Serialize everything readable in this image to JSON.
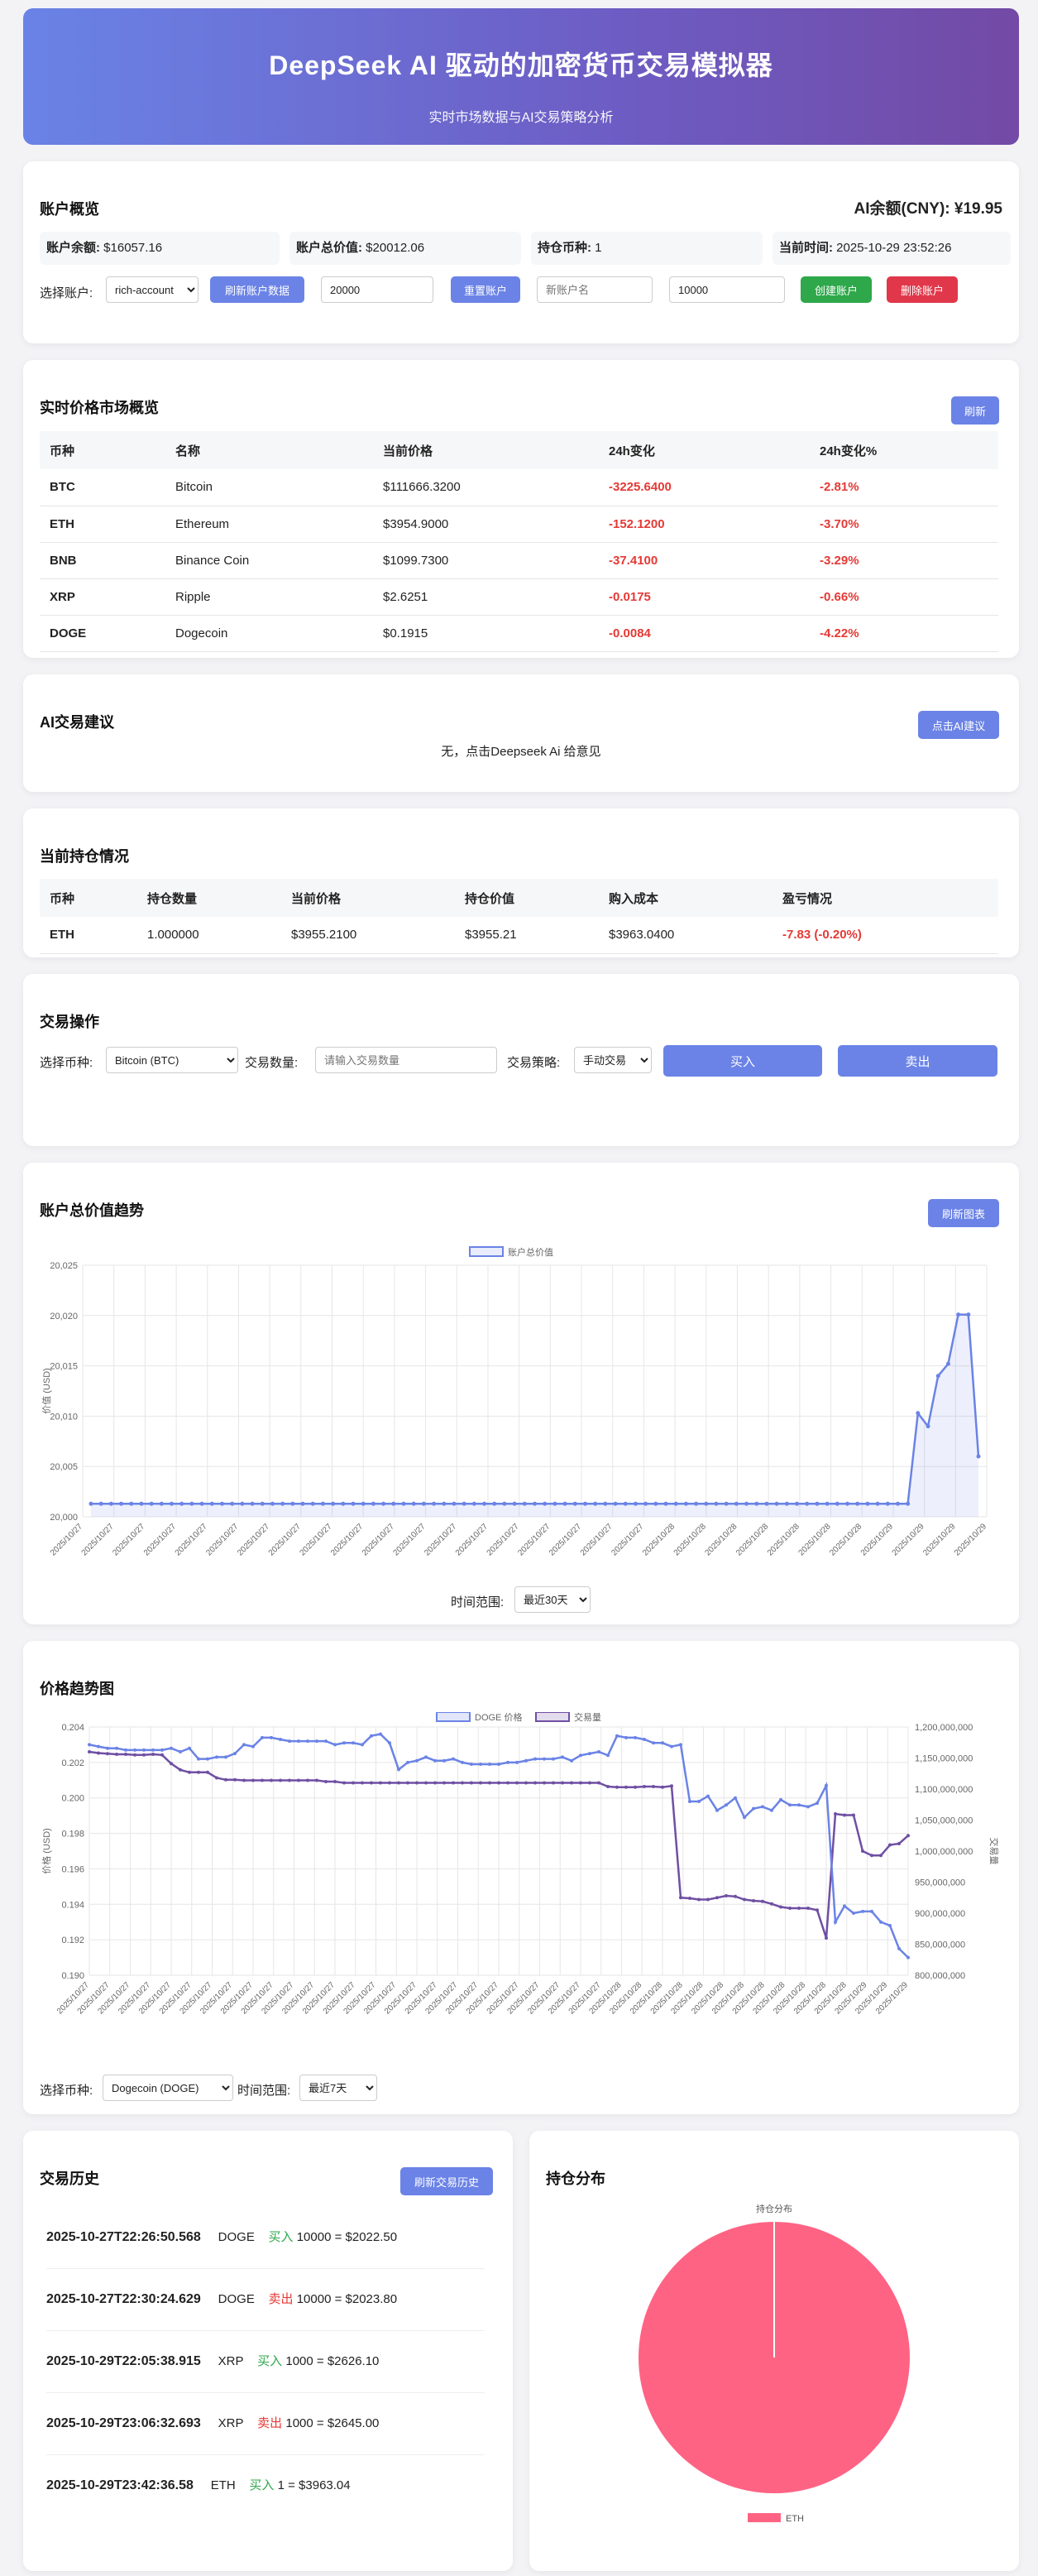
{
  "header": {
    "title": "DeepSeek AI 驱动的加密货币交易模拟器",
    "subtitle": "实时市场数据与AI交易策略分析"
  },
  "account": {
    "title": "账户概览",
    "ai_balance": "AI余额(CNY): ¥19.95",
    "balance_label": "账户余额:",
    "balance": "$16057.16",
    "total_label": "账户总价值:",
    "total": "$20012.06",
    "coins_label": "持仓币种:",
    "coins": "1",
    "time_label": "当前时间:",
    "time": "2025-10-29 23:52:26",
    "select_label": "选择账户:",
    "selected_account": "rich-account",
    "refresh_btn": "刷新账户数据",
    "reset_value": "20000",
    "reset_btn": "重置账户",
    "new_name_placeholder": "新账户名",
    "new_amount": "10000",
    "create_btn": "创建账户",
    "delete_btn": "删除账户"
  },
  "market": {
    "title": "实时价格市场概览",
    "refresh_btn": "刷新",
    "columns": [
      "币种",
      "名称",
      "当前价格",
      "24h变化",
      "24h变化%"
    ],
    "rows": [
      [
        "BTC",
        "Bitcoin",
        "$111666.3200",
        "-3225.6400",
        "-2.81%"
      ],
      [
        "ETH",
        "Ethereum",
        "$3954.9000",
        "-152.1200",
        "-3.70%"
      ],
      [
        "BNB",
        "Binance Coin",
        "$1099.7300",
        "-37.4100",
        "-3.29%"
      ],
      [
        "XRP",
        "Ripple",
        "$2.6251",
        "-0.0175",
        "-0.66%"
      ],
      [
        "DOGE",
        "Dogecoin",
        "$0.1915",
        "-0.0084",
        "-4.22%"
      ]
    ]
  },
  "ai": {
    "title": "AI交易建议",
    "btn": "点击AI建议",
    "text": "无，点击Deepseek Ai 给意见"
  },
  "holdings": {
    "title": "当前持仓情况",
    "columns": [
      "币种",
      "持仓数量",
      "当前价格",
      "持仓价值",
      "购入成本",
      "盈亏情况"
    ],
    "rows": [
      [
        "ETH",
        "1.000000",
        "$3955.2100",
        "$3955.21",
        "$3963.0400",
        "-7.83 (-0.20%)"
      ]
    ]
  },
  "trade": {
    "title": "交易操作",
    "coin_label": "选择币种:",
    "coin_value": "Bitcoin (BTC)",
    "qty_label": "交易数量:",
    "qty_placeholder": "请输入交易数量",
    "strategy_label": "交易策略:",
    "strategy_value": "手动交易",
    "buy_btn": "买入",
    "sell_btn": "卖出"
  },
  "value_chart": {
    "title": "账户总价值趋势",
    "refresh_btn": "刷新图表",
    "range_label": "时间范围:",
    "range_value": "最近30天"
  },
  "price_chart": {
    "title": "价格趋势图",
    "coin_label": "选择币种:",
    "coin_value": "Dogecoin (DOGE)",
    "range_label": "时间范围:",
    "range_value": "最近7天"
  },
  "history": {
    "title": "交易历史",
    "refresh_btn": "刷新交易历史",
    "items": [
      {
        "time": "2025-10-27T22:26:50.568",
        "coin": "DOGE",
        "side": "买入",
        "type": "buy",
        "detail": "10000 = $2022.50"
      },
      {
        "time": "2025-10-27T22:30:24.629",
        "coin": "DOGE",
        "side": "卖出",
        "type": "sell",
        "detail": "10000 = $2023.80"
      },
      {
        "time": "2025-10-29T22:05:38.915",
        "coin": "XRP",
        "side": "买入",
        "type": "buy",
        "detail": "1000 = $2626.10"
      },
      {
        "time": "2025-10-29T23:06:32.693",
        "coin": "XRP",
        "side": "卖出",
        "type": "sell",
        "detail": "1000 = $2645.00"
      },
      {
        "time": "2025-10-29T23:42:36.58",
        "coin": "ETH",
        "side": "买入",
        "type": "buy",
        "detail": "1 = $3963.04"
      }
    ]
  },
  "distribution": {
    "title": "持仓分布"
  },
  "chart_data": [
    {
      "type": "area",
      "title": "",
      "xlabel": "",
      "ylabel": "价值 (USD)",
      "ylim": [
        20000,
        20025
      ],
      "grid": true,
      "legend": "top-center",
      "color": "#6b83e6",
      "tick_label": "2025/10/27",
      "x_ticks": [
        "2025/10/27",
        "2025/10/27",
        "2025/10/27",
        "2025/10/27",
        "2025/10/27",
        "2025/10/27",
        "2025/10/27",
        "2025/10/27",
        "2025/10/27",
        "2025/10/27",
        "2025/10/27",
        "2025/10/27",
        "2025/10/27",
        "2025/10/27",
        "2025/10/27",
        "2025/10/27",
        "2025/10/27",
        "2025/10/27",
        "2025/10/27",
        "2025/10/28",
        "2025/10/28",
        "2025/10/28",
        "2025/10/28",
        "2025/10/28",
        "2025/10/28",
        "2025/10/28",
        "2025/10/29",
        "2025/10/29",
        "2025/10/29",
        "2025/10/29"
      ],
      "y_ticks": [
        "20,025",
        "20,020",
        "20,015",
        "20,010",
        "20,005",
        "20,000"
      ],
      "series": [
        {
          "name": "账户总价值",
          "values": [
            20001.3,
            20001.3,
            20001.3,
            20001.3,
            20001.3,
            20001.3,
            20001.3,
            20001.3,
            20001.3,
            20001.3,
            20001.3,
            20001.3,
            20001.3,
            20001.3,
            20001.3,
            20001.3,
            20001.3,
            20001.3,
            20001.3,
            20001.3,
            20001.3,
            20001.3,
            20001.3,
            20001.3,
            20001.3,
            20001.3,
            20001.3,
            20001.3,
            20001.3,
            20001.3,
            20001.3,
            20001.3,
            20001.3,
            20001.3,
            20001.3,
            20001.3,
            20001.3,
            20001.3,
            20001.3,
            20001.3,
            20001.3,
            20001.3,
            20001.3,
            20001.3,
            20001.3,
            20001.3,
            20001.3,
            20001.3,
            20001.3,
            20001.3,
            20001.3,
            20001.3,
            20001.3,
            20001.3,
            20001.3,
            20001.3,
            20001.3,
            20001.3,
            20001.3,
            20001.3,
            20001.3,
            20001.3,
            20001.3,
            20001.3,
            20001.3,
            20001.3,
            20001.3,
            20001.3,
            20001.3,
            20001.3,
            20001.3,
            20001.3,
            20001.3,
            20001.3,
            20001.3,
            20001.3,
            20001.3,
            20001.3,
            20001.3,
            20001.3,
            20001.3,
            20001.3,
            20010.3,
            20009.0,
            20014.0,
            20015.2,
            20020.1,
            20020.1,
            20006.0
          ]
        }
      ]
    },
    {
      "type": "line",
      "title": "",
      "xlabel": "",
      "ylabel": "价格 (USD)",
      "y2label": "交易量",
      "ylim": [
        0.19,
        0.204
      ],
      "y2lim": [
        800000000,
        1200000000
      ],
      "grid": true,
      "legend": "top-center",
      "x_ticks": [
        "2025/10/27",
        "2025/10/27",
        "2025/10/27",
        "2025/10/27",
        "2025/10/27",
        "2025/10/27",
        "2025/10/27",
        "2025/10/27",
        "2025/10/27",
        "2025/10/27",
        "2025/10/27",
        "2025/10/27",
        "2025/10/27",
        "2025/10/27",
        "2025/10/27",
        "2025/10/27",
        "2025/10/27",
        "2025/10/27",
        "2025/10/27",
        "2025/10/27",
        "2025/10/27",
        "2025/10/27",
        "2025/10/27",
        "2025/10/27",
        "2025/10/27",
        "2025/10/27",
        "2025/10/28",
        "2025/10/28",
        "2025/10/28",
        "2025/10/28",
        "2025/10/28",
        "2025/10/28",
        "2025/10/28",
        "2025/10/28",
        "2025/10/28",
        "2025/10/28",
        "2025/10/28",
        "2025/10/28",
        "2025/10/29",
        "2025/10/29",
        "2025/10/29"
      ],
      "y_ticks": [
        "0.204",
        "0.202",
        "0.200",
        "0.198",
        "0.196",
        "0.194",
        "0.192",
        "0.190"
      ],
      "y2_ticks": [
        "1,200,000,000",
        "1,150,000,000",
        "1,100,000,000",
        "1,050,000,000",
        "1,000,000,000",
        "950,000,000",
        "900,000,000",
        "850,000,000",
        "800,000,000"
      ],
      "series": [
        {
          "name": "DOGE 价格",
          "color": "#6b83e6",
          "values": [
            0.203,
            0.2029,
            0.2028,
            0.2028,
            0.2027,
            0.2027,
            0.2027,
            0.2027,
            0.2027,
            0.2028,
            0.2026,
            0.2028,
            0.2022,
            0.2022,
            0.2023,
            0.2023,
            0.2025,
            0.203,
            0.2029,
            0.2034,
            0.2034,
            0.2033,
            0.2032,
            0.2032,
            0.2032,
            0.2032,
            0.2032,
            0.203,
            0.2031,
            0.2031,
            0.203,
            0.2035,
            0.2036,
            0.2031,
            0.2016,
            0.202,
            0.2021,
            0.2023,
            0.2021,
            0.2021,
            0.2022,
            0.202,
            0.2019,
            0.2019,
            0.2019,
            0.2019,
            0.202,
            0.202,
            0.2021,
            0.2022,
            0.2022,
            0.2022,
            0.2023,
            0.2021,
            0.2024,
            0.2025,
            0.2026,
            0.2024,
            0.2035,
            0.2034,
            0.2034,
            0.2033,
            0.2031,
            0.2031,
            0.2029,
            0.203,
            0.1998,
            0.1998,
            0.2001,
            0.1993,
            0.1996,
            0.2,
            0.1989,
            0.1994,
            0.1995,
            0.1993,
            0.1999,
            0.1996,
            0.1996,
            0.1995,
            0.1997,
            0.2007,
            0.193,
            0.1939,
            0.1935,
            0.1936,
            0.1936,
            0.193,
            0.1928,
            0.1915,
            0.191
          ]
        },
        {
          "name": "交易量",
          "axis": "right",
          "color": "#6f4fa3",
          "values": [
            1160000000,
            1158000000,
            1157000000,
            1156000000,
            1156000000,
            1155000000,
            1155000000,
            1156000000,
            1155000000,
            1141000000,
            1131000000,
            1127000000,
            1127000000,
            1127000000,
            1118000000,
            1115000000,
            1115000000,
            1114000000,
            1114000000,
            1114000000,
            1114000000,
            1114000000,
            1114000000,
            1114000000,
            1114000000,
            1114000000,
            1112000000,
            1112000000,
            1110000000,
            1110000000,
            1110000000,
            1110000000,
            1110000000,
            1110000000,
            1110000000,
            1110000000,
            1110000000,
            1110000000,
            1110000000,
            1110000000,
            1110000000,
            1110000000,
            1110000000,
            1110000000,
            1110000000,
            1110000000,
            1110000000,
            1110000000,
            1110000000,
            1110000000,
            1110000000,
            1110000000,
            1110000000,
            1110000000,
            1110000000,
            1110000000,
            1110000000,
            1104000000,
            1103000000,
            1103000000,
            1103000000,
            1104000000,
            1104000000,
            1103000000,
            1105000000,
            925000000,
            924000000,
            922000000,
            922000000,
            925000000,
            928000000,
            927000000,
            922000000,
            920000000,
            919000000,
            915000000,
            910000000,
            908000000,
            908000000,
            908000000,
            905000000,
            860000000,
            1060000000,
            1058000000,
            1058000000,
            1000000000,
            993000000,
            993000000,
            1010000000,
            1012000000,
            1025000000
          ]
        }
      ]
    },
    {
      "type": "pie",
      "title": "持仓分布",
      "legend": "bottom",
      "slices": [
        {
          "label": "ETH",
          "value": 100,
          "color": "#ff6384"
        }
      ]
    }
  ]
}
